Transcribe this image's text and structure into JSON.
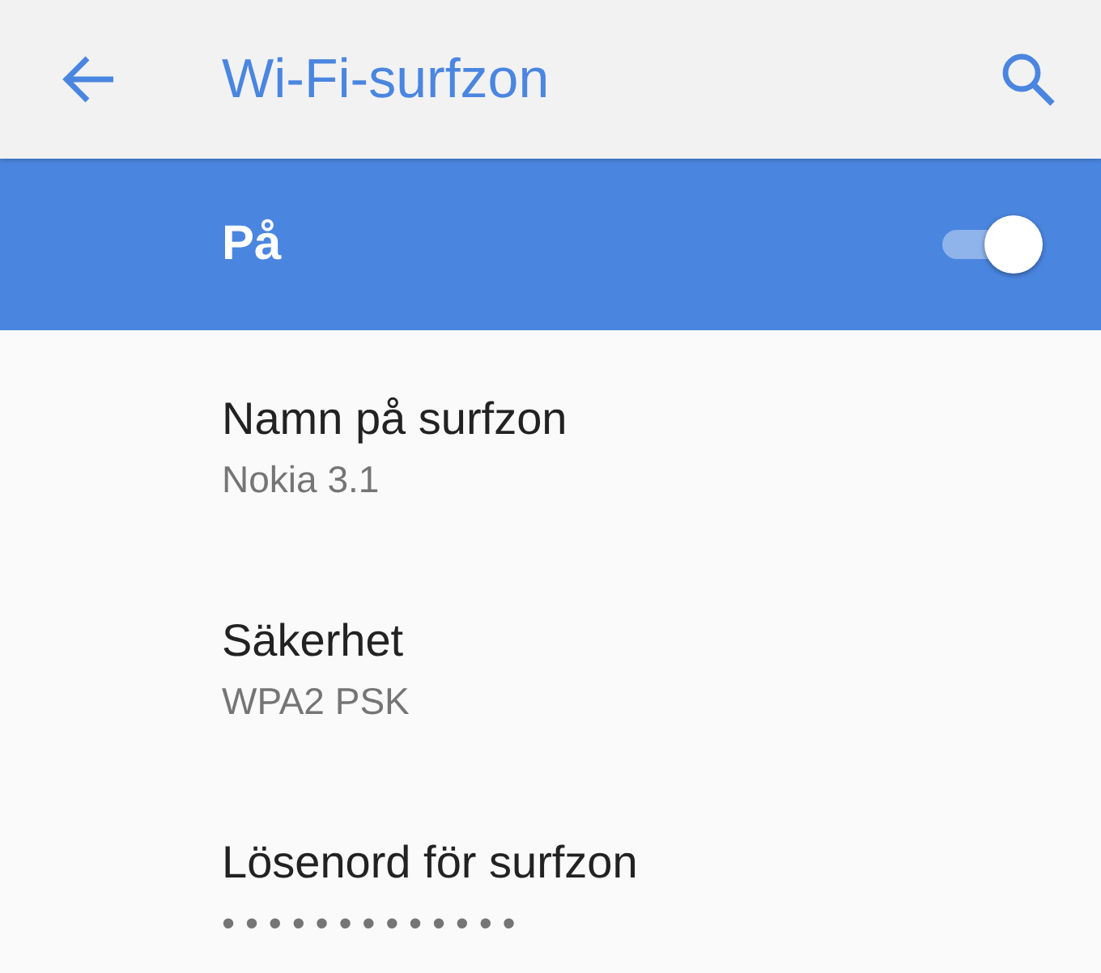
{
  "app_bar": {
    "title": "Wi-Fi-surfzon"
  },
  "master_switch": {
    "label": "På",
    "on": true
  },
  "settings": [
    {
      "title": "Namn på surfzon",
      "summary": "Nokia 3.1"
    },
    {
      "title": "Säkerhet",
      "summary": "WPA2 PSK"
    },
    {
      "title": "Lösenord för surfzon",
      "summary": "• • • • • • • • • • • • •"
    }
  ]
}
